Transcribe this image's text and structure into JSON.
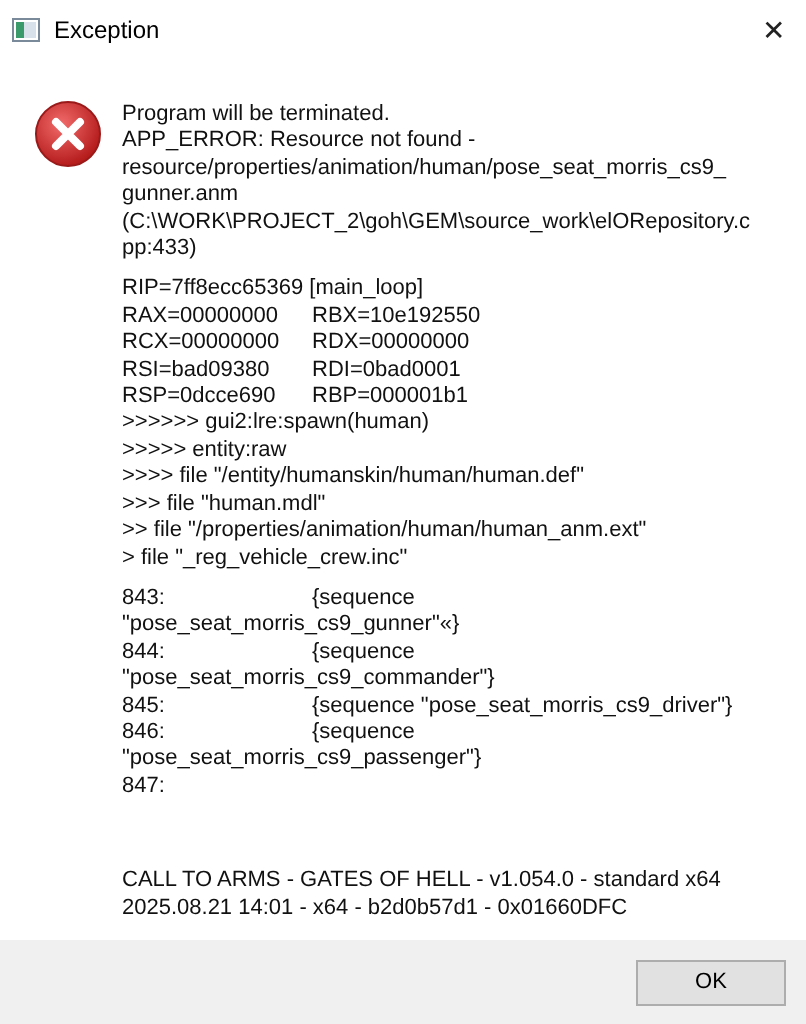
{
  "window": {
    "title": "Exception",
    "close": "✕"
  },
  "message": {
    "paragraphs": [
      {
        "lines": [
          {
            "text": "Program will be terminated."
          },
          {
            "text": "APP_ERROR: Resource not found -"
          },
          {
            "text": "resource/properties/animation/human/pose_seat_morris_cs9_"
          },
          {
            "text": "gunner.anm"
          },
          {
            "text": "(C:\\WORK\\PROJECT_2\\goh\\GEM\\source_work\\elORepository.c"
          },
          {
            "text": "pp:433)"
          }
        ]
      },
      {
        "lines": [
          {
            "text": "RIP=7ff8ecc65369 [main_loop]"
          },
          {
            "text": "RAX=00000000",
            "column_2": "RBX=10e192550"
          },
          {
            "text": "RCX=00000000",
            "column_2": "RDX=00000000"
          },
          {
            "text": "RSI=bad09380",
            "column_2": "RDI=0bad0001"
          },
          {
            "text": "RSP=0dcce690",
            "column_2": "RBP=000001b1"
          },
          {
            "text": ">>>>>> gui2:lre:spawn(human)"
          },
          {
            "text": ">>>>> entity:raw"
          },
          {
            "text": ">>>> file \"/entity/humanskin/human/human.def\""
          },
          {
            "text": ">>> file \"human.mdl\""
          },
          {
            "text": ">> file \"/properties/animation/human/human_anm.ext\""
          },
          {
            "text": "> file \"_reg_vehicle_crew.inc\""
          }
        ]
      },
      {
        "lines": [
          {
            "text": "843:",
            "column_2": "{sequence"
          },
          {
            "text": "\"pose_seat_morris_cs9_gunner\"«}"
          },
          {
            "text": "844:",
            "column_2": "{sequence"
          },
          {
            "text": "\"pose_seat_morris_cs9_commander\"}"
          },
          {
            "text": "845:",
            "column_2": "{sequence \"pose_seat_morris_cs9_driver\"}"
          },
          {
            "text": "846:",
            "column_2": "{sequence"
          },
          {
            "text": "\"pose_seat_morris_cs9_passenger\"}"
          },
          {
            "text": "847:"
          }
        ]
      },
      {
        "lines": [
          {
            "text": "CALL TO ARMS - GATES OF HELL - v1.054.0 - standard x64"
          },
          {
            "text": "2025.08.21 14:01 - x64 - b2d0b57d1 - 0x01660DFC"
          }
        ]
      }
    ]
  },
  "buttons": [
    "OK"
  ]
}
